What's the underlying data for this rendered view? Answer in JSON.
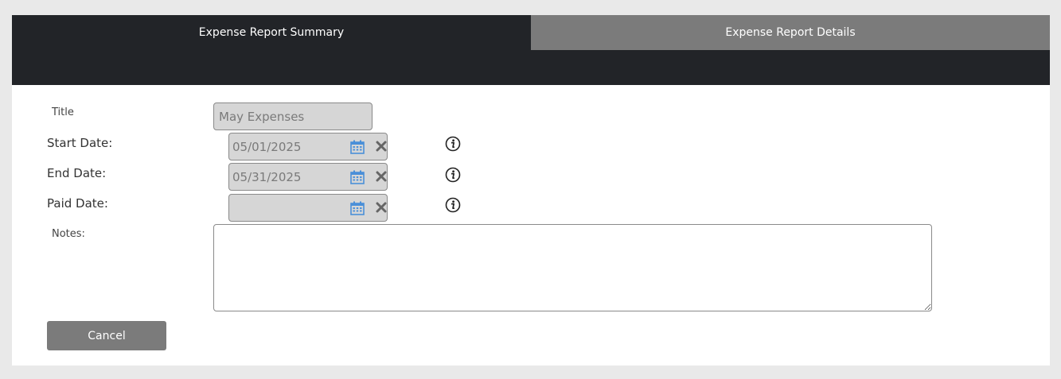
{
  "tabs": [
    {
      "label": "Expense Report Summary",
      "active": true
    },
    {
      "label": "Expense Report Details",
      "active": false
    }
  ],
  "form": {
    "title_label": "Title",
    "title_value": "May Expenses",
    "start_date_label": "Start Date:",
    "start_date_value": "05/01/2025",
    "end_date_label": "End Date:",
    "end_date_value": "05/31/2025",
    "paid_date_label": "Paid Date:",
    "paid_date_value": "",
    "notes_label": "Notes:",
    "notes_value": ""
  },
  "actions": {
    "cancel_label": "Cancel"
  },
  "icons": {
    "calendar": "calendar-icon",
    "clear": "close-icon",
    "info": "info-icon"
  },
  "colors": {
    "header_bg": "#222428",
    "inactive_tab_bg": "#7b7b7b",
    "calendar_icon": "#4a8fd8",
    "button_bg": "#7b7b7b"
  }
}
